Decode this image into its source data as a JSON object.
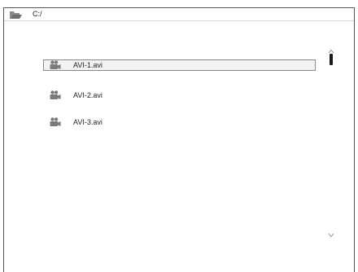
{
  "path_bar": {
    "icon": "folder-open-icon",
    "path": "C:/"
  },
  "files": [
    {
      "name": "AVI-1.avi",
      "icon": "video-camera-icon",
      "selected": true
    },
    {
      "name": "AVI-2.avi",
      "icon": "video-camera-icon",
      "selected": false
    },
    {
      "name": "AVI-3.avi",
      "icon": "video-camera-icon",
      "selected": false
    }
  ],
  "scrollbar": {
    "up_icon": "chevron-up-icon",
    "down_icon": "chevron-down-icon"
  },
  "colors": {
    "icon_gray": "#7a7a7a",
    "selection_border": "#8a8a8a",
    "selection_fill": "#f2f2f2",
    "window_border": "#555555"
  }
}
